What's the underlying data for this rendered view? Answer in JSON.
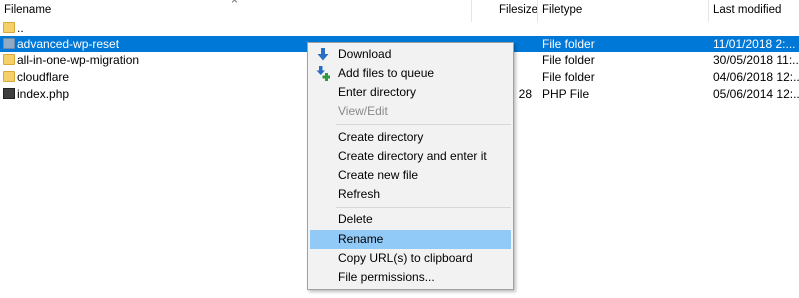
{
  "columns": {
    "filename": "Filename",
    "filesize": "Filesize",
    "filetype": "Filetype",
    "last_modified": "Last modified"
  },
  "close_glyph": "×",
  "files": [
    {
      "name": "..",
      "size": "",
      "type": "",
      "modified": "",
      "icon": "folder-icon"
    },
    {
      "name": "advanced-wp-reset",
      "size": "",
      "type": "File folder",
      "modified": "11/01/2018 2:...",
      "icon": "folder-icon",
      "selected": true
    },
    {
      "name": "all-in-one-wp-migration",
      "size": "",
      "type": "File folder",
      "modified": "30/05/2018 11:...",
      "icon": "folder-icon"
    },
    {
      "name": "cloudflare",
      "size": "",
      "type": "File folder",
      "modified": "04/06/2018 12:...",
      "icon": "folder-icon"
    },
    {
      "name": "index.php",
      "size": "28",
      "type": "PHP File",
      "modified": "05/06/2014 12:...",
      "icon": "php-file-icon"
    }
  ],
  "context_menu": {
    "download": "Download",
    "add_to_queue": "Add files to queue",
    "enter_directory": "Enter directory",
    "view_edit": "View/Edit",
    "create_directory": "Create directory",
    "create_directory_enter": "Create directory and enter it",
    "create_new_file": "Create new file",
    "refresh": "Refresh",
    "delete": "Delete",
    "rename": "Rename",
    "copy_url": "Copy URL(s) to clipboard",
    "file_permissions": "File permissions..."
  },
  "colors": {
    "selection": "#0078d7",
    "menu_highlight": "#91c9f7",
    "menu_background": "#f2f2f2",
    "folder": "#f5cf6a",
    "download_arrow": "#2a6fc4",
    "queue_plus": "#2e9b3c"
  }
}
